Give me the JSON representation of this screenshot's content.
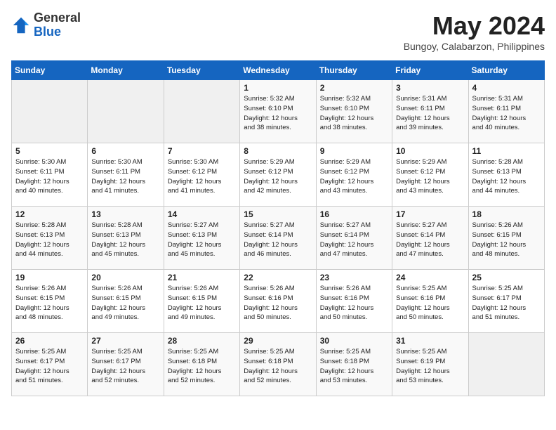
{
  "header": {
    "logo_general": "General",
    "logo_blue": "Blue",
    "month": "May 2024",
    "location": "Bungoy, Calabarzon, Philippines"
  },
  "weekdays": [
    "Sunday",
    "Monday",
    "Tuesday",
    "Wednesday",
    "Thursday",
    "Friday",
    "Saturday"
  ],
  "weeks": [
    [
      {
        "day": "",
        "info": ""
      },
      {
        "day": "",
        "info": ""
      },
      {
        "day": "",
        "info": ""
      },
      {
        "day": "1",
        "info": "Sunrise: 5:32 AM\nSunset: 6:10 PM\nDaylight: 12 hours\nand 38 minutes."
      },
      {
        "day": "2",
        "info": "Sunrise: 5:32 AM\nSunset: 6:10 PM\nDaylight: 12 hours\nand 38 minutes."
      },
      {
        "day": "3",
        "info": "Sunrise: 5:31 AM\nSunset: 6:11 PM\nDaylight: 12 hours\nand 39 minutes."
      },
      {
        "day": "4",
        "info": "Sunrise: 5:31 AM\nSunset: 6:11 PM\nDaylight: 12 hours\nand 40 minutes."
      }
    ],
    [
      {
        "day": "5",
        "info": "Sunrise: 5:30 AM\nSunset: 6:11 PM\nDaylight: 12 hours\nand 40 minutes."
      },
      {
        "day": "6",
        "info": "Sunrise: 5:30 AM\nSunset: 6:11 PM\nDaylight: 12 hours\nand 41 minutes."
      },
      {
        "day": "7",
        "info": "Sunrise: 5:30 AM\nSunset: 6:12 PM\nDaylight: 12 hours\nand 41 minutes."
      },
      {
        "day": "8",
        "info": "Sunrise: 5:29 AM\nSunset: 6:12 PM\nDaylight: 12 hours\nand 42 minutes."
      },
      {
        "day": "9",
        "info": "Sunrise: 5:29 AM\nSunset: 6:12 PM\nDaylight: 12 hours\nand 43 minutes."
      },
      {
        "day": "10",
        "info": "Sunrise: 5:29 AM\nSunset: 6:12 PM\nDaylight: 12 hours\nand 43 minutes."
      },
      {
        "day": "11",
        "info": "Sunrise: 5:28 AM\nSunset: 6:13 PM\nDaylight: 12 hours\nand 44 minutes."
      }
    ],
    [
      {
        "day": "12",
        "info": "Sunrise: 5:28 AM\nSunset: 6:13 PM\nDaylight: 12 hours\nand 44 minutes."
      },
      {
        "day": "13",
        "info": "Sunrise: 5:28 AM\nSunset: 6:13 PM\nDaylight: 12 hours\nand 45 minutes."
      },
      {
        "day": "14",
        "info": "Sunrise: 5:27 AM\nSunset: 6:13 PM\nDaylight: 12 hours\nand 45 minutes."
      },
      {
        "day": "15",
        "info": "Sunrise: 5:27 AM\nSunset: 6:14 PM\nDaylight: 12 hours\nand 46 minutes."
      },
      {
        "day": "16",
        "info": "Sunrise: 5:27 AM\nSunset: 6:14 PM\nDaylight: 12 hours\nand 47 minutes."
      },
      {
        "day": "17",
        "info": "Sunrise: 5:27 AM\nSunset: 6:14 PM\nDaylight: 12 hours\nand 47 minutes."
      },
      {
        "day": "18",
        "info": "Sunrise: 5:26 AM\nSunset: 6:15 PM\nDaylight: 12 hours\nand 48 minutes."
      }
    ],
    [
      {
        "day": "19",
        "info": "Sunrise: 5:26 AM\nSunset: 6:15 PM\nDaylight: 12 hours\nand 48 minutes."
      },
      {
        "day": "20",
        "info": "Sunrise: 5:26 AM\nSunset: 6:15 PM\nDaylight: 12 hours\nand 49 minutes."
      },
      {
        "day": "21",
        "info": "Sunrise: 5:26 AM\nSunset: 6:15 PM\nDaylight: 12 hours\nand 49 minutes."
      },
      {
        "day": "22",
        "info": "Sunrise: 5:26 AM\nSunset: 6:16 PM\nDaylight: 12 hours\nand 50 minutes."
      },
      {
        "day": "23",
        "info": "Sunrise: 5:26 AM\nSunset: 6:16 PM\nDaylight: 12 hours\nand 50 minutes."
      },
      {
        "day": "24",
        "info": "Sunrise: 5:25 AM\nSunset: 6:16 PM\nDaylight: 12 hours\nand 50 minutes."
      },
      {
        "day": "25",
        "info": "Sunrise: 5:25 AM\nSunset: 6:17 PM\nDaylight: 12 hours\nand 51 minutes."
      }
    ],
    [
      {
        "day": "26",
        "info": "Sunrise: 5:25 AM\nSunset: 6:17 PM\nDaylight: 12 hours\nand 51 minutes."
      },
      {
        "day": "27",
        "info": "Sunrise: 5:25 AM\nSunset: 6:17 PM\nDaylight: 12 hours\nand 52 minutes."
      },
      {
        "day": "28",
        "info": "Sunrise: 5:25 AM\nSunset: 6:18 PM\nDaylight: 12 hours\nand 52 minutes."
      },
      {
        "day": "29",
        "info": "Sunrise: 5:25 AM\nSunset: 6:18 PM\nDaylight: 12 hours\nand 52 minutes."
      },
      {
        "day": "30",
        "info": "Sunrise: 5:25 AM\nSunset: 6:18 PM\nDaylight: 12 hours\nand 53 minutes."
      },
      {
        "day": "31",
        "info": "Sunrise: 5:25 AM\nSunset: 6:19 PM\nDaylight: 12 hours\nand 53 minutes."
      },
      {
        "day": "",
        "info": ""
      }
    ]
  ]
}
